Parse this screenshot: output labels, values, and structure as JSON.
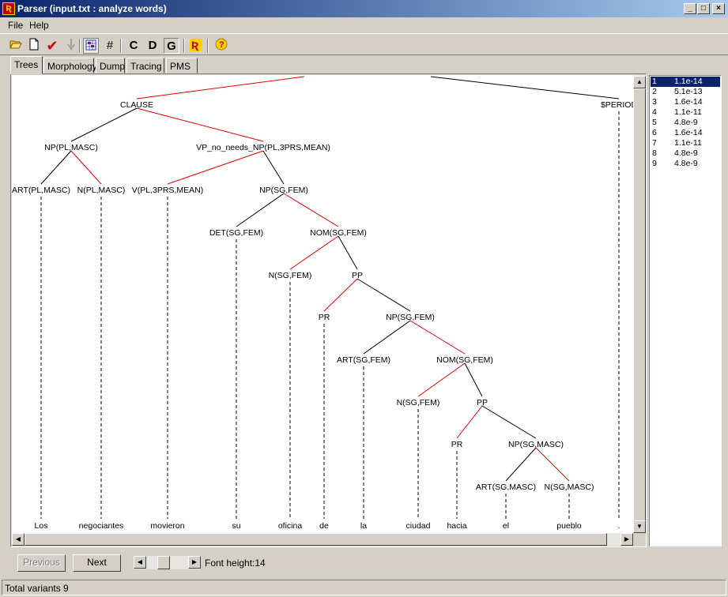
{
  "window": {
    "title": "Parser (input.txt : analyze words)",
    "icon": "app-icon"
  },
  "menu": [
    "File",
    "Help"
  ],
  "toolbar": {
    "c_label": "C",
    "d_label": "D",
    "g_label": "G",
    "hash_label": "#"
  },
  "tabs": [
    "Trees",
    "Morphology",
    "Dump",
    "Tracing",
    "PMS"
  ],
  "tree": {
    "nodes": [
      {
        "id": "clause",
        "label": "CLAUSE"
      },
      {
        "id": "period",
        "label": "$PERIOD"
      },
      {
        "id": "np1",
        "label": "NP(PL,MASC)"
      },
      {
        "id": "vp",
        "label": "VP_no_needs_NP(PL,3PRS,MEAN)"
      },
      {
        "id": "art1",
        "label": "ART(PL,MASC)"
      },
      {
        "id": "n1",
        "label": "N(PL,MASC)"
      },
      {
        "id": "v",
        "label": "V(PL,3PRS,MEAN)"
      },
      {
        "id": "np2",
        "label": "NP(SG,FEM)"
      },
      {
        "id": "det",
        "label": "DET(SG,FEM)"
      },
      {
        "id": "nom1",
        "label": "NOM(SG,FEM)"
      },
      {
        "id": "n2",
        "label": "N(SG,FEM)"
      },
      {
        "id": "pp1",
        "label": "PP"
      },
      {
        "id": "pr1",
        "label": "PR"
      },
      {
        "id": "np3",
        "label": "NP(SG,FEM)"
      },
      {
        "id": "art2",
        "label": "ART(SG,FEM)"
      },
      {
        "id": "nom2",
        "label": "NOM(SG,FEM)"
      },
      {
        "id": "n3",
        "label": "N(SG,FEM)"
      },
      {
        "id": "pp2",
        "label": "PP"
      },
      {
        "id": "pr2",
        "label": "PR"
      },
      {
        "id": "np4",
        "label": "NP(SG,MASC)"
      },
      {
        "id": "art3",
        "label": "ART(SG,MASC)"
      },
      {
        "id": "n4",
        "label": "N(SG,MASC)"
      }
    ],
    "words": [
      "Los",
      "negociantes",
      "movieron",
      "su",
      "oficina",
      "de",
      "la",
      "ciudad",
      "hacia",
      "el",
      "pueblo",
      "."
    ],
    "highlight_color": "#e00000",
    "line_color": "#000000"
  },
  "variants": [
    {
      "num": "1",
      "value": "1.1e-14"
    },
    {
      "num": "2",
      "value": "5.1e-13"
    },
    {
      "num": "3",
      "value": "1.6e-14"
    },
    {
      "num": "4",
      "value": "1.1e-11"
    },
    {
      "num": "5",
      "value": "4.8e-9"
    },
    {
      "num": "6",
      "value": "1.6e-14"
    },
    {
      "num": "7",
      "value": "1.1e-11"
    },
    {
      "num": "8",
      "value": "4.8e-9"
    },
    {
      "num": "9",
      "value": "4.8e-9"
    }
  ],
  "bottom": {
    "previous": "Previous",
    "next": "Next",
    "font_height": "Font height:14"
  },
  "status": "Total variants 9"
}
